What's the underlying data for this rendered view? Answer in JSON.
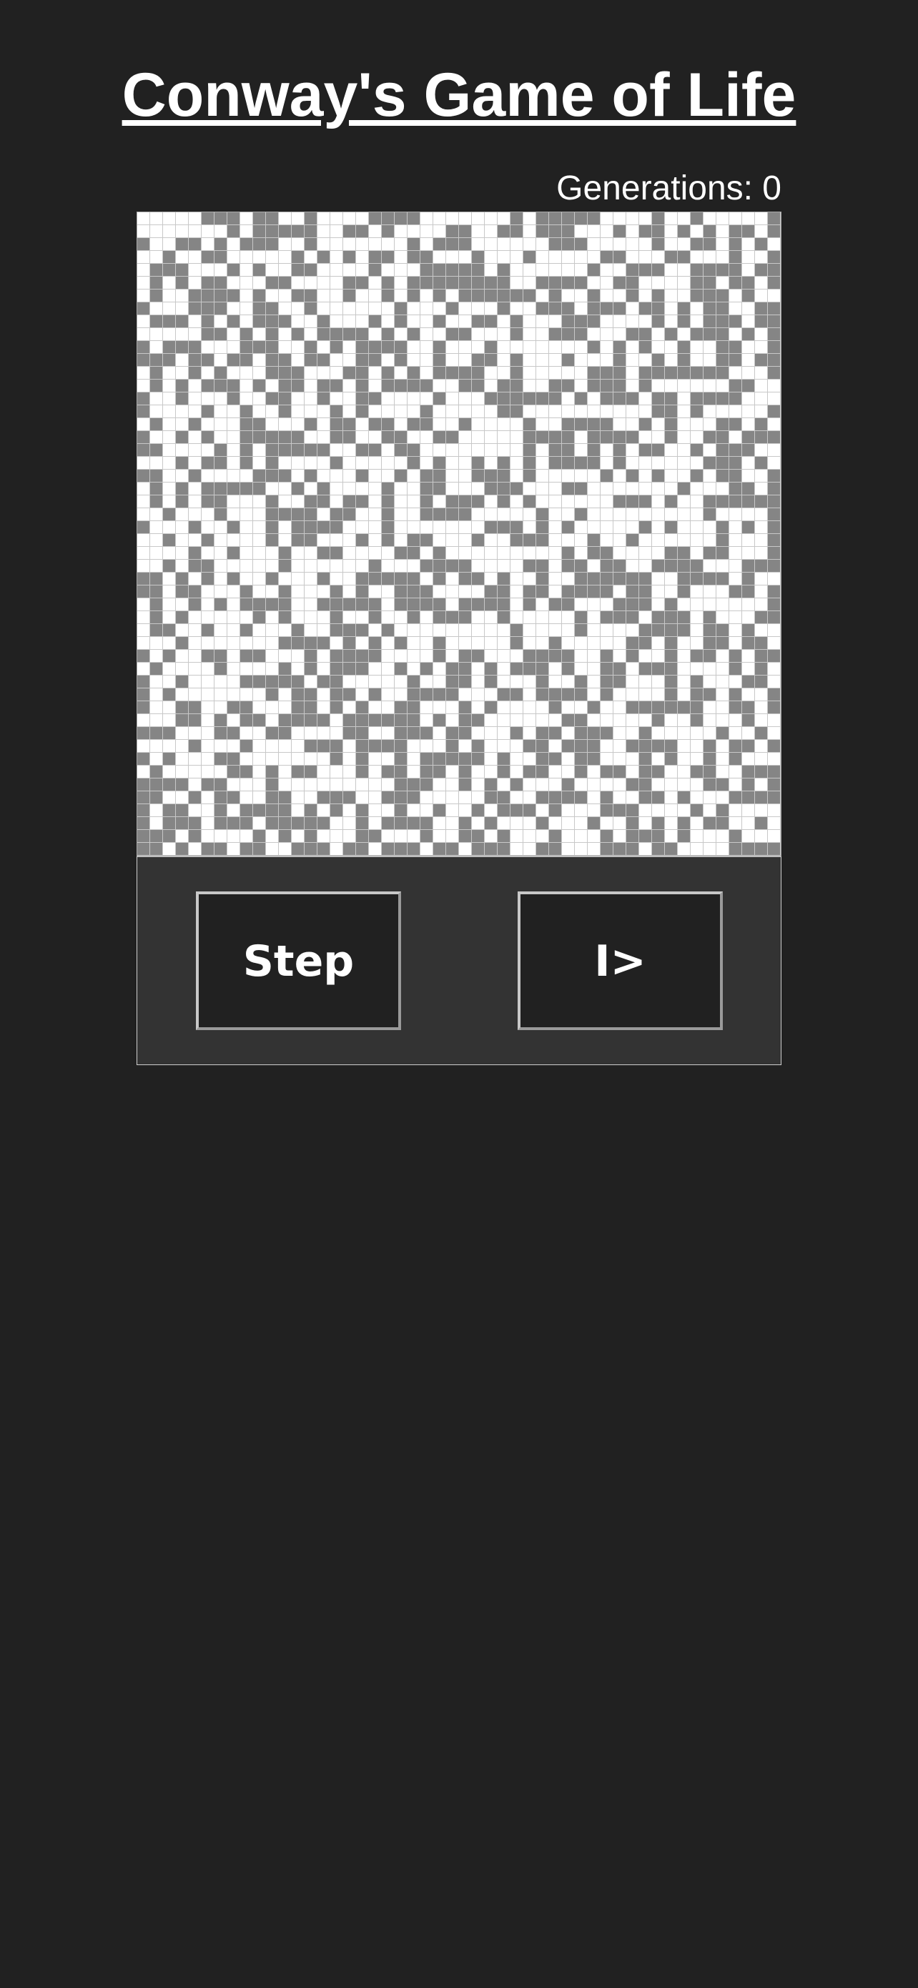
{
  "header": {
    "title": "Conway's Game of Life"
  },
  "status": {
    "generations_text": "Generations: 0"
  },
  "board": {
    "columns": 50,
    "rows": 50,
    "alive_color": "#858585",
    "dead_color": "#ffffff",
    "grid_line_color": "#c8c8c8"
  },
  "controls": {
    "step_label": "Step",
    "play_label": "I>"
  }
}
